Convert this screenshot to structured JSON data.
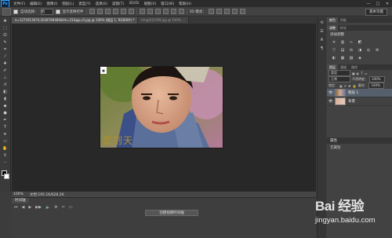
{
  "app": {
    "logo": "Ps"
  },
  "menu": [
    "文件(F)",
    "编辑(E)",
    "图像(I)",
    "图层(L)",
    "类型(Y)",
    "选择(S)",
    "滤镜(T)",
    "3D(D)",
    "视图(V)",
    "窗口(W)",
    "帮助(H)"
  ],
  "window_controls": [
    "—",
    "□",
    "✕"
  ],
  "options_bar": {
    "auto_select_label": "自动选择：",
    "auto_select_value": "组",
    "show_transform_label": "显示变换控件",
    "mode_label": "3D 模式：",
    "workspace": "基本功能"
  },
  "tabs": [
    {
      "label": "e=1271913670,2638789480&fm=21&gp=0.jpg @ 100% (图层 1, RGB/8#) *",
      "active": true
    },
    {
      "label": "timg(6)5799.jpg @ 100% ...",
      "active": false
    }
  ],
  "status": {
    "zoom": "100%",
    "doc": "文档:195.1K/628.2K"
  },
  "timeline": {
    "tab_label": "时间轴",
    "create_button": "创建视频时间轴",
    "controls": [
      "⏮",
      "◀",
      "▶",
      "▶▶",
      "🔈",
      "⚙",
      "✂",
      "▭"
    ]
  },
  "panels": {
    "top_tabs": [
      "颜色",
      "色板"
    ],
    "adjust_tabs": [
      "调整",
      "样式"
    ],
    "adjust_title": "添加调整",
    "layers_tabs": [
      "图层",
      "通道",
      "路径"
    ],
    "kind_label": "类型",
    "blend_mode": "正常",
    "opacity_label": "不透明度：",
    "opacity_value": "100%",
    "lock_label": "锁定：",
    "fill_label": "填充：",
    "fill_value": "100%",
    "layers": [
      {
        "name": "图层 1",
        "selected": true
      },
      {
        "name": "背景",
        "selected": false
      }
    ],
    "info_tab": "属性",
    "info_value": "无属性"
  },
  "watermark": {
    "main": "Bai 经验",
    "url": "jingyan.baidu.com"
  },
  "colors": {
    "bg": "#3c3c3c",
    "canvas": "#282828",
    "accent": "#31a8ff"
  }
}
